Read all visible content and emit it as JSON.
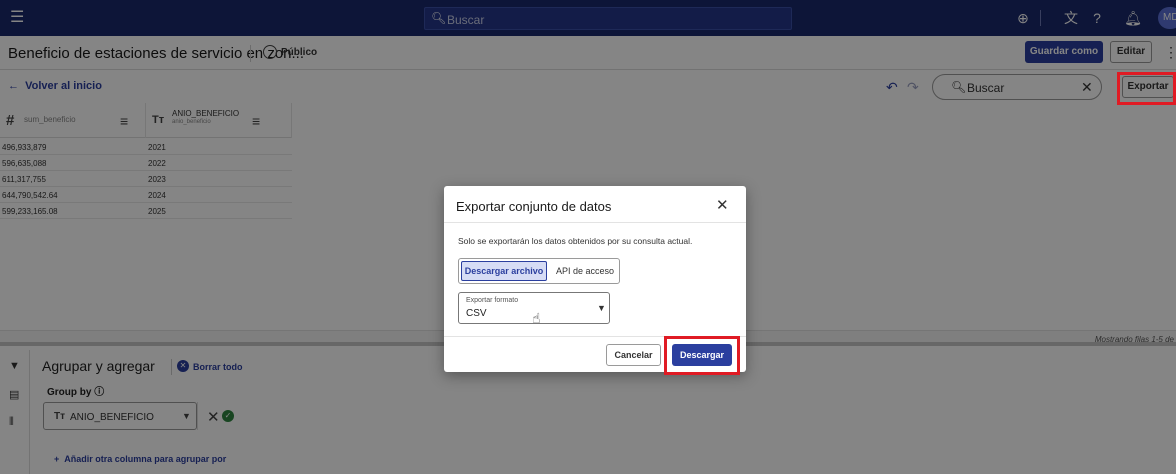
{
  "topbar": {
    "search_placeholder": "Buscar",
    "avatar_initials": "MD"
  },
  "titlebar": {
    "title": "Beneficio de estaciones de servicio en zon...",
    "visibility": "Público",
    "save_as_label": "Guardar como",
    "edit_label": "Editar"
  },
  "toolbar": {
    "back_label": "Volver al inicio",
    "search_placeholder": "Buscar",
    "export_label": "Exportar"
  },
  "grid": {
    "columns": [
      {
        "label": "sum_beneficio",
        "sublabel": ""
      },
      {
        "label": "ANIO_BENEFICIO",
        "sublabel": "anio_beneficio"
      }
    ],
    "rows": [
      [
        "496,933,879",
        "2021"
      ],
      [
        "596,635,088",
        "2022"
      ],
      [
        "611,317,755",
        "2023"
      ],
      [
        "644,790,542.64",
        "2024"
      ],
      [
        "599,233,165.08",
        "2025"
      ]
    ],
    "status": "Mostrando filas 1-5 de"
  },
  "group_panel": {
    "title": "Agrupar y agregar",
    "clear_label": "Borrar todo",
    "group_by_label": "Group by",
    "selected_column": "ANIO_BENEFICIO",
    "add_column_label": "Añadir otra columna para agrupar por"
  },
  "modal": {
    "title": "Exportar conjunto de datos",
    "note": "Solo se exportarán los datos obtenidos por su consulta actual.",
    "tab_download": "Descargar archivo",
    "tab_api": "API de acceso",
    "format_label": "Exportar formato",
    "format_value": "CSV",
    "cancel_label": "Cancelar",
    "download_label": "Descargar"
  },
  "colors": {
    "topbar": "#1a2a6c",
    "primary": "#2b3f9f",
    "highlight": "#e01b24"
  }
}
